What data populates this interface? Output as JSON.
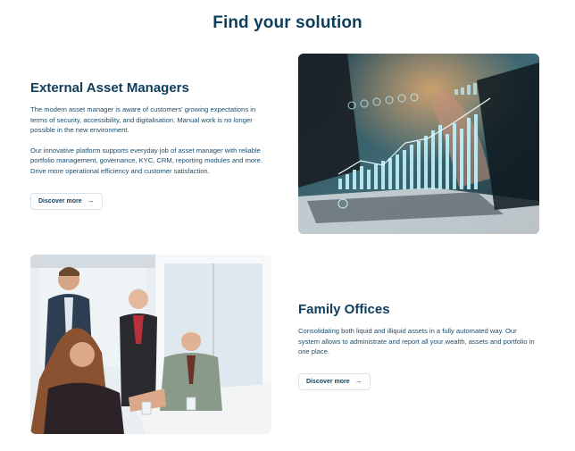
{
  "page_title": "Find your solution",
  "sections": [
    {
      "heading": "External Asset Managers",
      "paragraphs": [
        "The modern asset manager is aware of customers' growing expectations in terms of security, accessibility, and digitalisation. Manual work is no longer possible in the new environment.",
        "Our innovative platform supports everyday job of asset manager with reliable portfolio management, governance, KYC, CRM, reporting modules and more. Drive more operational efficiency and customer satisfaction."
      ],
      "button_label": "Discover more",
      "image_alt": "Laptop with holographic financial charts",
      "arrow_icon": "arrow-right-icon"
    },
    {
      "heading": "Family Offices",
      "paragraphs": [
        "Consolidating both liquid and illiquid assets in a fully automated way. Our system allows to administrate and report all your wealth, assets and portfolio in one place."
      ],
      "button_label": "Discover more",
      "image_alt": "Business team meeting in an office",
      "arrow_icon": "arrow-right-icon"
    }
  ],
  "colors": {
    "heading": "#0f3d5c",
    "body_text": "#1d4d6b",
    "button_border": "#d9e2ea"
  }
}
